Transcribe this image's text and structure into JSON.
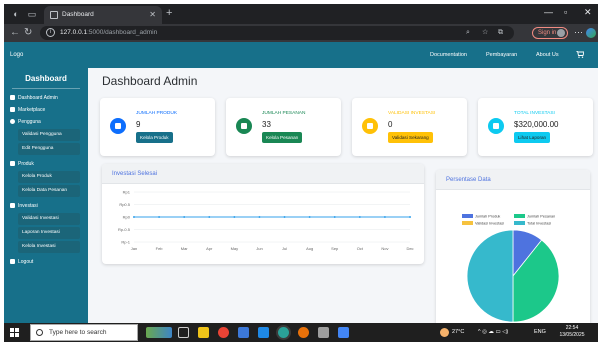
{
  "browser": {
    "tab_title": "Dashboard",
    "url_host": "127.0.0.1",
    "url_path": ":5000/dashboard_admin",
    "signin_label": "Sign in"
  },
  "topnav": {
    "logo": "Logo",
    "links": [
      "Documentation",
      "Pembayaran",
      "About Us"
    ]
  },
  "sidebar": {
    "title": "Dashboard",
    "items": {
      "dashboard_admin": "Dashboard Admin",
      "marketplace": "Marketplace",
      "pengguna": "Pengguna",
      "validasi_pengguna": "Validasi Pengguna",
      "edit_pengguna": "Edit Pengguna",
      "produk": "Produk",
      "kelola_produk": "Kelola Produk",
      "kelola_data_pesanan": "Kelola Data Pesanan",
      "investasi": "Investasi",
      "validasi_investasi": "Validasi Investasi",
      "laporan_investasi": "Laporan Investasi",
      "kelola_investasi": "Kelola Investasi",
      "logout": "Logout"
    }
  },
  "main": {
    "title": "Dashboard Admin",
    "cards": [
      {
        "label": "JUMLAH PRODUK",
        "value": "9",
        "button": "Kelola Produk",
        "color": "#0d6efd",
        "label_color": "#0d6efd",
        "button_color": "#17708a",
        "icon": "box-icon"
      },
      {
        "label": "JUMLAH PESANAN",
        "value": "33",
        "button": "Kelola Pesanan",
        "color": "#198754",
        "label_color": "#198754",
        "button_color": "#198754",
        "icon": "cart-icon"
      },
      {
        "label": "VALIDASI INVESTASI",
        "value": "0",
        "button": "Validasi Sekarang",
        "color": "#ffc107",
        "label_color": "#ffc107",
        "button_color": "#ffc107",
        "icon": "check-icon"
      },
      {
        "label": "TOTAL INVESTASI",
        "value": "$320,000.00",
        "button": "Lihat Laporan",
        "color": "#0dcaf0",
        "label_color": "#0dcaf0",
        "button_color": "#0dcaf0",
        "icon": "dollar-icon"
      }
    ],
    "line_panel_title": "Investasi Selesai",
    "pie_panel_title": "Persentase Data"
  },
  "chart_data": [
    {
      "type": "line",
      "title": "Investasi Selesai",
      "categories": [
        "Jan",
        "Feb",
        "Mar",
        "Apr",
        "May",
        "Jun",
        "Jul",
        "Aug",
        "Sep",
        "Oct",
        "Nov",
        "Dec"
      ],
      "series": [
        {
          "values": [
            0,
            0,
            0,
            0,
            0,
            0,
            0,
            0,
            0,
            0,
            0,
            0
          ],
          "color": "#36a2eb"
        }
      ],
      "y_ticks": [
        "Rp1",
        "Rp0.5",
        "Rp0",
        "Rp-0.5",
        "Rp-1"
      ],
      "ylim": [
        -1,
        1
      ],
      "grid": true
    },
    {
      "type": "pie",
      "title": "Persentase Data",
      "legend": [
        "Jumlah Produk",
        "Jumlah Pesanan",
        "Validasi Investasi",
        "Total Investasi"
      ],
      "values": [
        9,
        33,
        0,
        42
      ],
      "colors": [
        "#4e73df",
        "#1cc88a",
        "#f6c23e",
        "#36b9cc"
      ],
      "legend_position": "top"
    }
  ],
  "taskbar": {
    "search_placeholder": "Type here to search",
    "weather": "27°C",
    "lang": "ENG",
    "time": "22:54",
    "date": "13/05/2025"
  }
}
